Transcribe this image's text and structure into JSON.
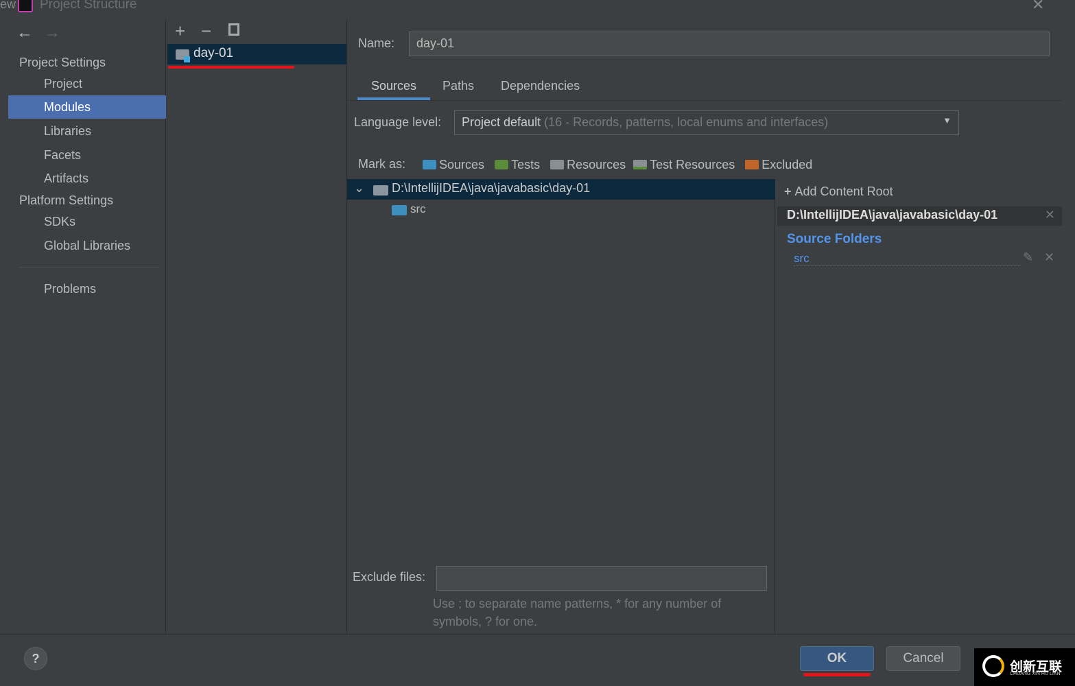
{
  "window": {
    "title": "Project Structure",
    "left_edge_text": "ew"
  },
  "sidebar": {
    "sections": [
      {
        "label": "Project Settings",
        "items": [
          "Project",
          "Modules",
          "Libraries",
          "Facets",
          "Artifacts"
        ]
      },
      {
        "label": "Platform Settings",
        "items": [
          "SDKs",
          "Global Libraries"
        ]
      }
    ],
    "problems": "Problems",
    "selected": "Modules"
  },
  "modules": {
    "items": [
      "day-01"
    ]
  },
  "detail": {
    "name_label": "Name:",
    "name_value": "day-01",
    "tabs": [
      "Sources",
      "Paths",
      "Dependencies"
    ],
    "active_tab": "Sources",
    "language_level_label": "Language level:",
    "language_level_value": "Project default",
    "language_level_hint": "(16 - Records, patterns, local enums and interfaces)",
    "mark_as_label": "Mark as:",
    "mark_as": [
      {
        "label": "Sources",
        "color": "#3d8fc0"
      },
      {
        "label": "Tests",
        "color": "#5a8c3c"
      },
      {
        "label": "Resources",
        "color": "#8a8f94"
      },
      {
        "label": "Test Resources",
        "color": "#8a8f94"
      },
      {
        "label": "Excluded",
        "color": "#c0652c"
      }
    ],
    "tree": {
      "root": "D:\\IntellijIDEA\\java\\javabasic\\day-01",
      "children": [
        "src"
      ]
    },
    "exclude_label": "Exclude files:",
    "exclude_value": "",
    "exclude_hint": "Use ; to separate name patterns, * for any number of symbols, ? for one."
  },
  "content_root": {
    "add_label": "Add Content Root",
    "path": "D:\\IntellijIDEA\\java\\javabasic\\day-01",
    "source_folders_label": "Source Folders",
    "source_folders": [
      "src"
    ]
  },
  "buttons": {
    "ok": "OK",
    "cancel": "Cancel",
    "help": "?"
  },
  "watermark": {
    "text": "创新互联",
    "sub": "CHUANG XIN HU LIAN"
  }
}
